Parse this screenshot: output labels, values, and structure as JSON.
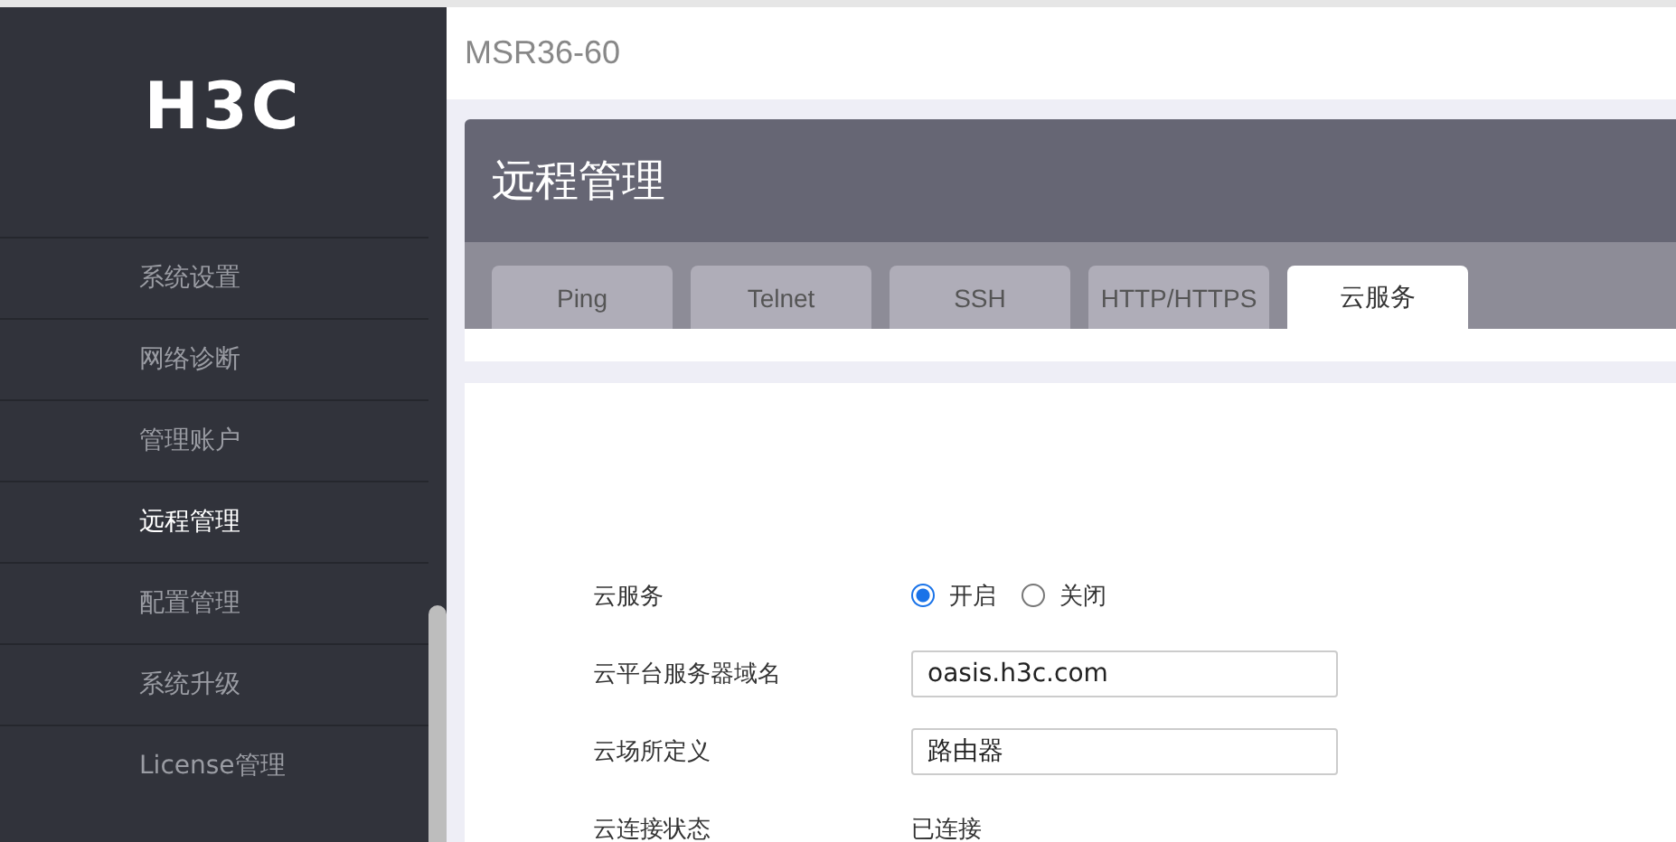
{
  "logo": "H3C",
  "sidebar": {
    "items": [
      {
        "label": "系统设置",
        "selected": false
      },
      {
        "label": "网络诊断",
        "selected": false
      },
      {
        "label": "管理账户",
        "selected": false
      },
      {
        "label": "远程管理",
        "selected": true
      },
      {
        "label": "配置管理",
        "selected": false
      },
      {
        "label": "系统升级",
        "selected": false
      },
      {
        "label": "License管理",
        "selected": false
      }
    ]
  },
  "header": {
    "device": "MSR36-60"
  },
  "page": {
    "title": "远程管理",
    "tabs": [
      {
        "label": "Ping",
        "selected": false
      },
      {
        "label": "Telnet",
        "selected": false
      },
      {
        "label": "SSH",
        "selected": false
      },
      {
        "label": "HTTP/HTTPS",
        "selected": false
      },
      {
        "label": "云服务",
        "selected": true
      }
    ],
    "form": [
      {
        "kind": "radio",
        "label": "云服务",
        "options": [
          {
            "label": "开启",
            "selected": true
          },
          {
            "label": "关闭",
            "selected": false
          }
        ]
      },
      {
        "kind": "input",
        "label": "云平台服务器域名",
        "value": "oasis.h3c.com"
      },
      {
        "kind": "input",
        "label": "云场所定义",
        "value": "路由器"
      },
      {
        "kind": "text",
        "label": "云连接状态",
        "value": "已连接"
      }
    ]
  }
}
